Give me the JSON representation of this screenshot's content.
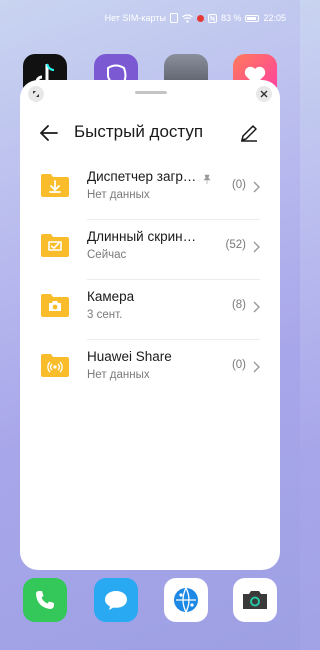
{
  "status_bar": {
    "carrier": "Нет SIM-карты",
    "battery_percent": "83 %",
    "time": "22:05"
  },
  "top_apps": [
    {
      "icon": "tiktok-app-icon"
    },
    {
      "icon": "viber-app-icon"
    },
    {
      "icon": "game-app-icon"
    },
    {
      "icon": "likee-app-icon"
    }
  ],
  "panel": {
    "title": "Быстрый доступ",
    "items": [
      {
        "name": "Диспетчер загрузок",
        "subtitle": "Нет данных",
        "count": "(0)",
        "pinned": true,
        "icon": "download-folder-icon"
      },
      {
        "name": "Длинный скриншот",
        "subtitle": "Сейчас",
        "count": "(52)",
        "pinned": false,
        "icon": "screenshot-folder-icon"
      },
      {
        "name": "Камера",
        "subtitle": "3 сент.",
        "count": "(8)",
        "pinned": false,
        "icon": "camera-folder-icon"
      },
      {
        "name": "Huawei Share",
        "subtitle": "Нет данных",
        "count": "(0)",
        "pinned": false,
        "icon": "share-folder-icon"
      }
    ]
  },
  "dock": [
    {
      "icon": "phone-app-icon"
    },
    {
      "icon": "messages-app-icon"
    },
    {
      "icon": "browser-app-icon"
    },
    {
      "icon": "camera-app-icon"
    }
  ],
  "colors": {
    "folder": "#f9bd2c",
    "folder_dark": "#e8a818",
    "text": "#1a1a1a",
    "secondary": "#7a7a7a"
  }
}
